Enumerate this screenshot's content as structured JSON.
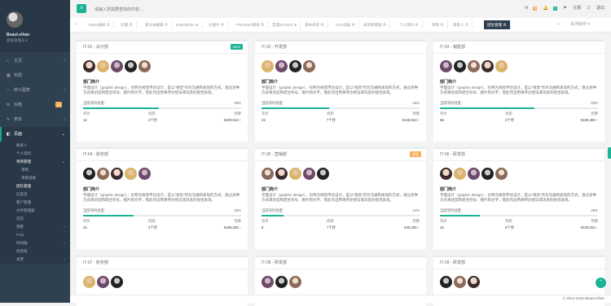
{
  "user": {
    "name": "Beaut-zihan",
    "role": "超级管理员 ▾"
  },
  "sidebar": {
    "items": [
      {
        "icon": "⌂",
        "label": "主页",
        "arrow": "‹",
        "top": 0
      },
      {
        "icon": "▦",
        "label": "布局"
      },
      {
        "icon": "◔",
        "label": "统计图表",
        "arrow": "‹"
      },
      {
        "icon": "✉",
        "label": "信箱",
        "badge": "16"
      },
      {
        "icon": "✎",
        "label": "表单",
        "arrow": "‹"
      }
    ],
    "active": {
      "icon": "◧",
      "label": "页面",
      "arrow": "⌄"
    },
    "sub": [
      {
        "label": "联系人"
      },
      {
        "label": "个人资料"
      },
      {
        "label": "项目管理",
        "strong": true,
        "arrow": "⌄"
      },
      {
        "label": "项目",
        "deep": true
      },
      {
        "label": "项目详情",
        "deep": true
      },
      {
        "label": "团队管理",
        "strong": true
      },
      {
        "label": "信息流"
      },
      {
        "label": "客户管理"
      },
      {
        "label": "文件管理器"
      },
      {
        "label": "日历"
      },
      {
        "label": "博客",
        "arrow": "‹"
      },
      {
        "label": "FAQ"
      },
      {
        "label": "时间轴",
        "arrow": "‹"
      },
      {
        "label": "标签墙"
      },
      {
        "label": "发票",
        "arrow": "‹"
      }
    ]
  },
  "topbar": {
    "menu_icon": "≡",
    "search_placeholder": "请输入您需要查找的内容…",
    "mail_badge": "8",
    "bell_badge": "4",
    "theme_label": "主题",
    "logout_label": "退出"
  },
  "tabs": {
    "prev": "«",
    "items": [
      "Toastr通知 ⊗",
      "日期 ⊗",
      "富文本编辑 ⊗",
      "DataTables ⊗",
      "大图片 ⊗",
      "Flotcharts图表 ⊗",
      "百度ECharts ⊗",
      "基本表单 ⊗",
      "CSS动画 ⊗",
      "表单构建器 ⊗",
      "个人资料 ⊗",
      "项目 ⊗",
      "联系人 ⊗",
      "团队管理 ⊗"
    ],
    "next": "»",
    "close": "关闭操作 ▾"
  },
  "cards": [
    {
      "title": "IT-01 - 设计部",
      "tag": "NEW",
      "tag_color": "#1ab394",
      "faces": 5,
      "label": "部门简介",
      "desc": "平面设计（graphic design），也称为视觉传达设计，是以“视觉”作为沟通和表现的方式，透过多种方式来创造和结合符号、图片和文字，借此作出用来传达想法或讯息的视觉表现。",
      "prog_label": "当前项目进度：",
      "pct": "48%",
      "progress": 0.48,
      "s1": "项目",
      "v1": "12",
      "s2": "周期",
      "v2": "4个月",
      "s3": "预算",
      "v3": "¥200,913 ↑"
    },
    {
      "title": "IT-02 - 开发部",
      "tag": "",
      "tag_color": "",
      "faces": 4,
      "label": "部门简介",
      "desc": "平面设计（graphic design），也称为视觉传达设计，是以“视觉”作为沟通和表现的方式，透过多种方式来创造和结合符号、图片和文字，借此作出用来传达想法或讯息的视觉表现。",
      "prog_label": "当前项目进度：",
      "pct": "43%",
      "progress": 0.43,
      "s1": "项目",
      "v1": "23",
      "s2": "周期",
      "v2": "7个月",
      "s3": "预算",
      "v3": "¥140,913 ↑"
    },
    {
      "title": "IT-03 - 销售部",
      "tag": "",
      "tag_color": "",
      "faces": 5,
      "label": "部门简介",
      "desc": "平面设计（graphic design），也称为视觉传达设计，是以“视觉”作为沟通和表现的方式，透过多种方式来创造和结合符号、图片和文字，借此作出用来传达想法或讯息的视觉表现。",
      "prog_label": "当前项目进度：",
      "pct": "60%",
      "progress": 0.6,
      "s1": "项目",
      "v1": "68",
      "s2": "周期",
      "v2": "2个月",
      "s3": "预算",
      "v3": "¥160,493 ↑"
    },
    {
      "title": "IT-04 - 财务部",
      "tag": "",
      "tag_color": "",
      "faces": 5,
      "label": "部门简介",
      "desc": "平面设计（graphic design），也称为视觉传达设计，是以“视觉”作为沟通和表现的方式，透过多种方式来创造和结合符号、图片和文字，借此作出用来传达想法或讯息的视觉表现。",
      "prog_label": "当前项目进度：",
      "pct": "32%",
      "progress": 0.32,
      "s1": "项目",
      "v1": "24",
      "s2": "周期",
      "v2": "3个月",
      "s3": "预算",
      "v3": "¥190,325 ↓"
    },
    {
      "title": "IT-05 - 营销部",
      "tag": "紧急",
      "tag_color": "#f8ac59",
      "faces": 5,
      "label": "部门简介",
      "desc": "平面设计（graphic design），也称为视觉传达设计，是以“视觉”作为沟通和表现的方式，透过多种方式来创造和结合符号、图片和文字，借此作出用来传达想法或讯息的视觉表现。",
      "prog_label": "当前项目进度：",
      "pct": "14%",
      "progress": 0.14,
      "s1": "项目",
      "v1": "8",
      "s2": "周期",
      "v2": "7个月",
      "s3": "预算",
      "v3": "¥40,200 ↑"
    },
    {
      "title": "IT-06 - 研发部",
      "tag": "",
      "tag_color": "",
      "faces": 5,
      "label": "部门简介",
      "desc": "平面设计（graphic design），也称为视觉传达设计，是以“视觉”作为沟通和表现的方式，透过多种方式来创造和结合符号、图片和文字，借此作出用来传达想法或讯息的视觉表现。",
      "prog_label": "当前项目进度：",
      "pct": "25%",
      "progress": 0.25,
      "s1": "项目",
      "v1": "16",
      "s2": "周期",
      "v2": "8个月",
      "s3": "预算",
      "v3": "¥120,913 ↓"
    },
    {
      "title": "IT-07 - 财务部",
      "tag": "",
      "tag_color": "",
      "faces": 3
    },
    {
      "title": "IT-08 - 研发部",
      "tag": "",
      "tag_color": "",
      "faces": 3
    },
    {
      "title": "IT-09 - 研发部",
      "tag": "",
      "tag_color": "",
      "faces": 3
    }
  ],
  "footer": "© 2014-2015 Beaut-zihan"
}
